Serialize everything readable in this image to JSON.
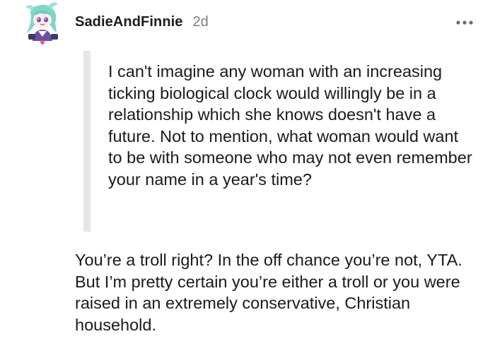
{
  "comment": {
    "author": "SadieAndFinnie",
    "age": "2d",
    "more_icon": "ellipsis-icon",
    "avatar_icon": "anime-character-avatar",
    "quote": "I can't imagine any woman with an increasing ticking biological clock would willingly be in a relationship which she knows doesn't have a future. Not to mention, what woman would want to be with someone who may not even remember your name in a year's time?",
    "body": "You’re a troll right? In the off chance you’re not, YTA. But I’m pretty certain you’re either a troll or you were raised in an extremely conservative, Christian household."
  },
  "colors": {
    "quote_bar": "#e6e6e6",
    "muted_text": "#7c7c7c",
    "body_text": "#1a1a1b"
  }
}
